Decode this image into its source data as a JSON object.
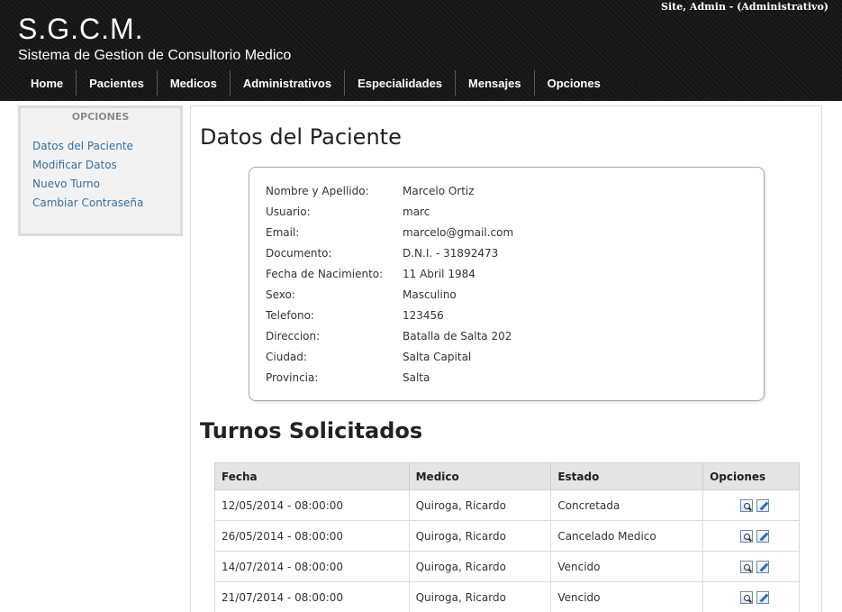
{
  "header": {
    "user_info": "Site, Admin - (Administrativo)",
    "title": "S.G.C.M.",
    "subtitle": "Sistema de Gestion de Consultorio Medico"
  },
  "nav": {
    "items": [
      {
        "label": "Home"
      },
      {
        "label": "Pacientes"
      },
      {
        "label": "Medicos"
      },
      {
        "label": "Administrativos"
      },
      {
        "label": "Especialidades"
      },
      {
        "label": "Mensajes"
      },
      {
        "label": "Opciones"
      }
    ]
  },
  "sidebar": {
    "title": "OPCIONES",
    "items": [
      {
        "label": "Datos del Paciente"
      },
      {
        "label": "Modificar Datos"
      },
      {
        "label": "Nuevo Turno"
      },
      {
        "label": "Cambiar Contraseña"
      }
    ]
  },
  "patient": {
    "heading": "Datos del Paciente",
    "fields": [
      {
        "label": "Nombre y Apellido:",
        "value": "Marcelo Ortiz"
      },
      {
        "label": "Usuario:",
        "value": "marc"
      },
      {
        "label": "Email:",
        "value": "marcelo@gmail.com"
      },
      {
        "label": "Documento:",
        "value": "D.N.I. - 31892473"
      },
      {
        "label": "Fecha de Nacimiento:",
        "value": "11 Abril 1984"
      },
      {
        "label": "Sexo:",
        "value": "Masculino"
      },
      {
        "label": "Telefono:",
        "value": "123456"
      },
      {
        "label": "Direccion:",
        "value": "Batalla de Salta 202"
      },
      {
        "label": "Ciudad:",
        "value": "Salta Capital"
      },
      {
        "label": "Provincia:",
        "value": "Salta"
      }
    ]
  },
  "turnos": {
    "heading": "Turnos Solicitados",
    "columns": [
      "Fecha",
      "Medico",
      "Estado",
      "Opciones"
    ],
    "rows": [
      {
        "fecha": "12/05/2014 - 08:00:00",
        "medico": "Quiroga, Ricardo",
        "estado": "Concretada"
      },
      {
        "fecha": "26/05/2014 - 08:00:00",
        "medico": "Quiroga, Ricardo",
        "estado": "Cancelado Medico"
      },
      {
        "fecha": "14/07/2014 - 08:00:00",
        "medico": "Quiroga, Ricardo",
        "estado": "Vencido"
      },
      {
        "fecha": "21/07/2014 - 08:00:00",
        "medico": "Quiroga, Ricardo",
        "estado": "Vencido"
      }
    ],
    "row_icons": [
      "view-icon",
      "edit-icon"
    ]
  }
}
